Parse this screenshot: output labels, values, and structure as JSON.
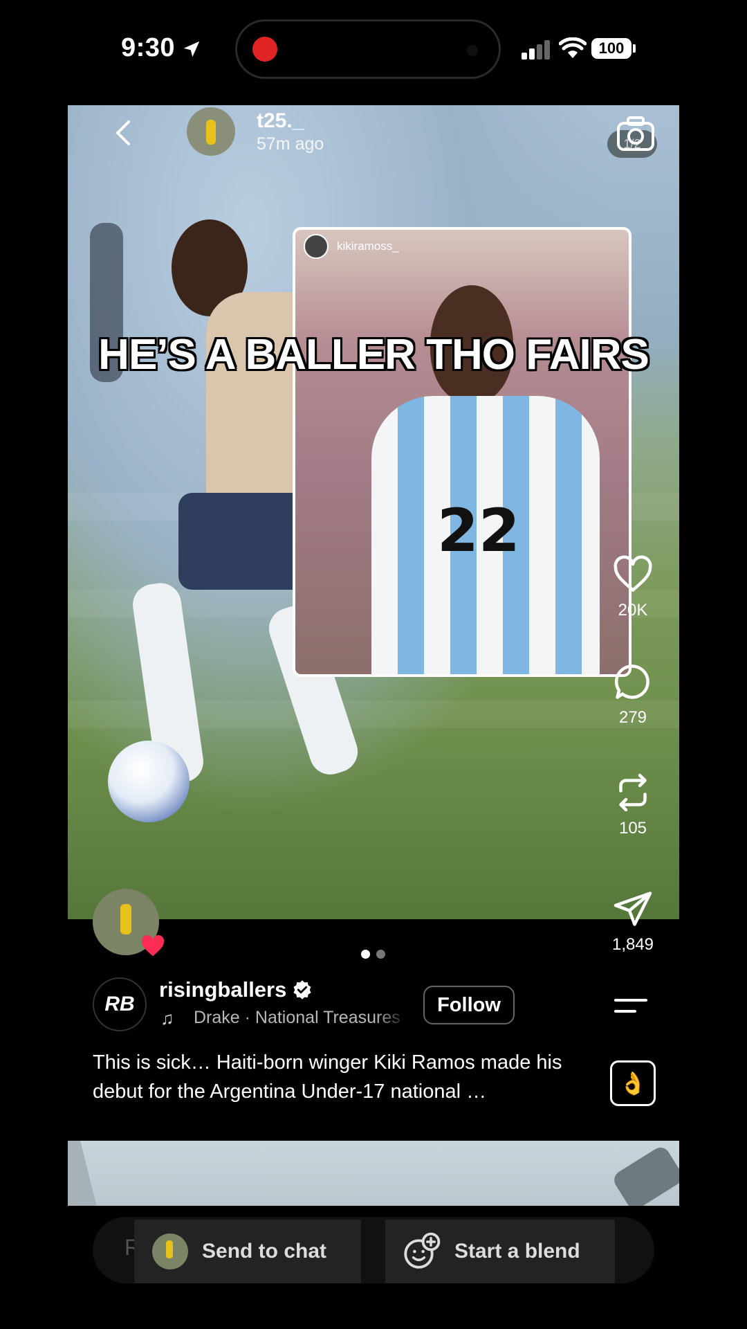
{
  "status_bar": {
    "time": "9:30",
    "battery": "100"
  },
  "post": {
    "username": "t25._",
    "time_ago": "57m ago",
    "page_indicator": "1/2",
    "overlay_text": "HE’S A BALLER THO FAIRS",
    "inset_username": "kikiramoss_",
    "jersey_number": "22"
  },
  "actions": {
    "likes": "20K",
    "comments": "279",
    "reposts": "105",
    "shares": "1,849"
  },
  "carousel": {
    "total": 2,
    "active": 0
  },
  "author": {
    "logo_text": "RB",
    "name": "risingballers",
    "music": "Drake · National Treasures",
    "follow_label": "Follow"
  },
  "caption": "This is sick… Haiti-born winger Kiki Ramos made his debut for the Argentina Under-17 national …",
  "bottom_bar": {
    "reply_hint": "R",
    "send_to_chat": "Send to chat",
    "start_blend": "Start a blend"
  },
  "colors": {
    "heart_badge": "#ff2d55",
    "record_dot": "#e02424"
  }
}
